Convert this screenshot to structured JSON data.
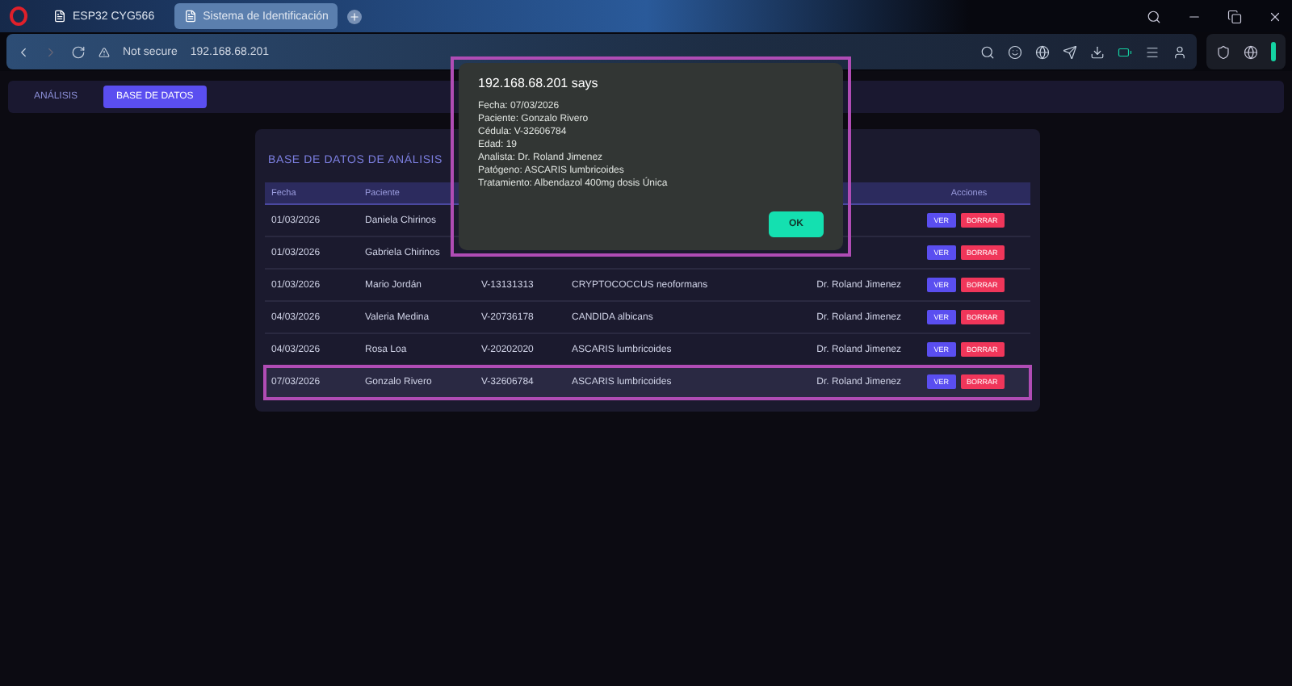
{
  "browser": {
    "tabs": [
      {
        "title": "ESP32 CYG566",
        "selected": false
      },
      {
        "title": "Sistema de Identificación",
        "selected": true
      }
    ],
    "security": "Not secure",
    "address": "192.168.68.201"
  },
  "nav": {
    "tabs": [
      {
        "label": "ANÁLISIS",
        "selected": false
      },
      {
        "label": "BASE DE DATOS",
        "selected": true
      }
    ]
  },
  "card": {
    "title": "BASE DE DATOS DE ANÁLISIS",
    "columns": [
      {
        "label": "Fecha"
      },
      {
        "label": "Paciente"
      },
      {},
      {},
      {},
      {
        "label": "Acciones"
      }
    ],
    "rows": [
      {
        "fecha": "01/03/2026",
        "paciente": "Daniela Chirinos",
        "selected": false,
        "actions": [
          "VER",
          "BORRAR"
        ]
      },
      {
        "fecha": "01/03/2026",
        "paciente": "Gabriela Chirinos",
        "selected": false,
        "actions": [
          "VER",
          "BORRAR"
        ]
      },
      {
        "fecha": "01/03/2026",
        "paciente": "Mario Jordán",
        "cedula": "V-13131313",
        "patogeno": "CRYPTOCOCCUS neoformans",
        "analista": "Dr. Roland Jimenez",
        "selected": false,
        "actions": [
          "VER",
          "BORRAR"
        ]
      },
      {
        "fecha": "04/03/2026",
        "paciente": "Valeria Medina",
        "cedula": "V-20736178",
        "patogeno": "CANDIDA albicans",
        "analista": "Dr. Roland Jimenez",
        "selected": false,
        "actions": [
          "VER",
          "BORRAR"
        ]
      },
      {
        "fecha": "04/03/2026",
        "paciente": "Rosa Loa",
        "cedula": "V-20202020",
        "patogeno": "ASCARIS lumbricoides",
        "analista": "Dr. Roland Jimenez",
        "selected": false,
        "actions": [
          "VER",
          "BORRAR"
        ]
      },
      {
        "fecha": "07/03/2026",
        "paciente": "Gonzalo Rivero",
        "cedula": "V-32606784",
        "patogeno": "ASCARIS lumbricoides",
        "analista": "Dr. Roland Jimenez",
        "selected": true,
        "actions": [
          "VER",
          "BORRAR"
        ]
      }
    ]
  },
  "dialog": {
    "title": "192.168.68.201 says",
    "lines": [
      "Fecha: 07/03/2026",
      "Paciente: Gonzalo Rivero",
      "Cédula: V-32606784",
      "Edad: 19",
      "Analista: Dr. Roland Jimenez",
      "Patógeno: ASCARIS lumbricoides",
      "Tratamiento: Albendazol 400mg dosis Única"
    ],
    "button": "OK"
  }
}
